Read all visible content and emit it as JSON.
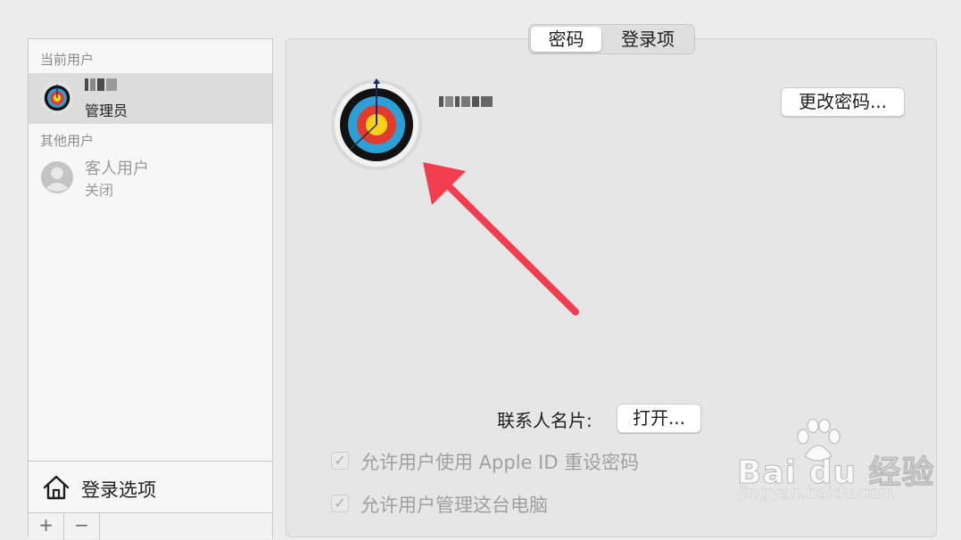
{
  "sidebar": {
    "current_users_header": "当前用户",
    "other_users_header": "其他用户",
    "current_user": {
      "role": "管理员"
    },
    "guest_user": {
      "name": "客人用户",
      "status": "关闭"
    },
    "login_options_label": "登录选项",
    "footer": {
      "add": "+",
      "remove": "−"
    }
  },
  "tabs": [
    {
      "label": "密码",
      "active": true
    },
    {
      "label": "登录项",
      "active": false
    }
  ],
  "main": {
    "change_password_button": "更改密码...",
    "contact_card_label": "联系人名片:",
    "open_button": "打开...",
    "checkboxes": [
      {
        "label": "允许用户使用 Apple ID 重设密码",
        "checked": true,
        "enabled": false
      },
      {
        "label": "允许用户管理这台电脑",
        "checked": true,
        "enabled": false
      }
    ]
  },
  "annotation": {
    "arrow_color": "#f23d4f"
  },
  "watermark": {
    "brand": "Bai du 经验",
    "url": "jingyan.baidu.com"
  }
}
